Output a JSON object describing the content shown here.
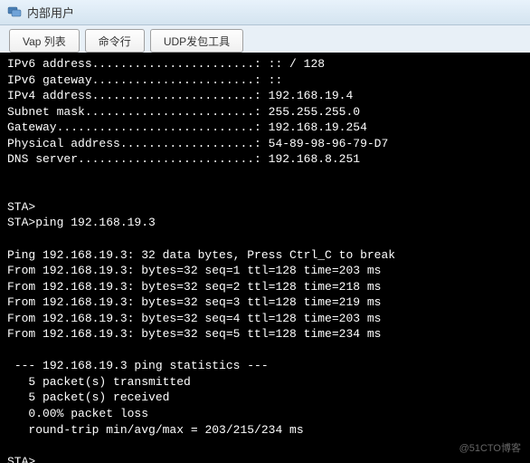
{
  "window": {
    "title": "内部用户"
  },
  "tabs": [
    {
      "label": "Vap 列表"
    },
    {
      "label": "命令行"
    },
    {
      "label": "UDP发包工具"
    }
  ],
  "terminal": {
    "network_info": {
      "ipv6_address_label": "IPv6 address.......................: ",
      "ipv6_address_value": ":: / 128",
      "ipv6_gateway_label": "IPv6 gateway.......................: ",
      "ipv6_gateway_value": "::",
      "ipv4_address_label": "IPv4 address.......................: ",
      "ipv4_address_value": "192.168.19.4",
      "subnet_mask_label": "Subnet mask........................: ",
      "subnet_mask_value": "255.255.255.0",
      "gateway_label": "Gateway............................: ",
      "gateway_value": "192.168.19.254",
      "physical_address_label": "Physical address...................: ",
      "physical_address_value": "54-89-98-96-79-D7",
      "dns_server_label": "DNS server.........................: ",
      "dns_server_value": "192.168.8.251"
    },
    "prompt1": "STA>",
    "command_line": "STA>ping 192.168.19.3",
    "ping_header": "Ping 192.168.19.3: 32 data bytes, Press Ctrl_C to break",
    "ping_replies": [
      "From 192.168.19.3: bytes=32 seq=1 ttl=128 time=203 ms",
      "From 192.168.19.3: bytes=32 seq=2 ttl=128 time=218 ms",
      "From 192.168.19.3: bytes=32 seq=3 ttl=128 time=219 ms",
      "From 192.168.19.3: bytes=32 seq=4 ttl=128 time=203 ms",
      "From 192.168.19.3: bytes=32 seq=5 ttl=128 time=234 ms"
    ],
    "stats_header": " --- 192.168.19.3 ping statistics ---",
    "stats_transmitted": "   5 packet(s) transmitted",
    "stats_received": "   5 packet(s) received",
    "stats_loss": "   0.00% packet loss",
    "stats_rtt": "   round-trip min/avg/max = 203/215/234 ms",
    "prompt2": "STA>"
  },
  "watermark": "@51CTO博客"
}
